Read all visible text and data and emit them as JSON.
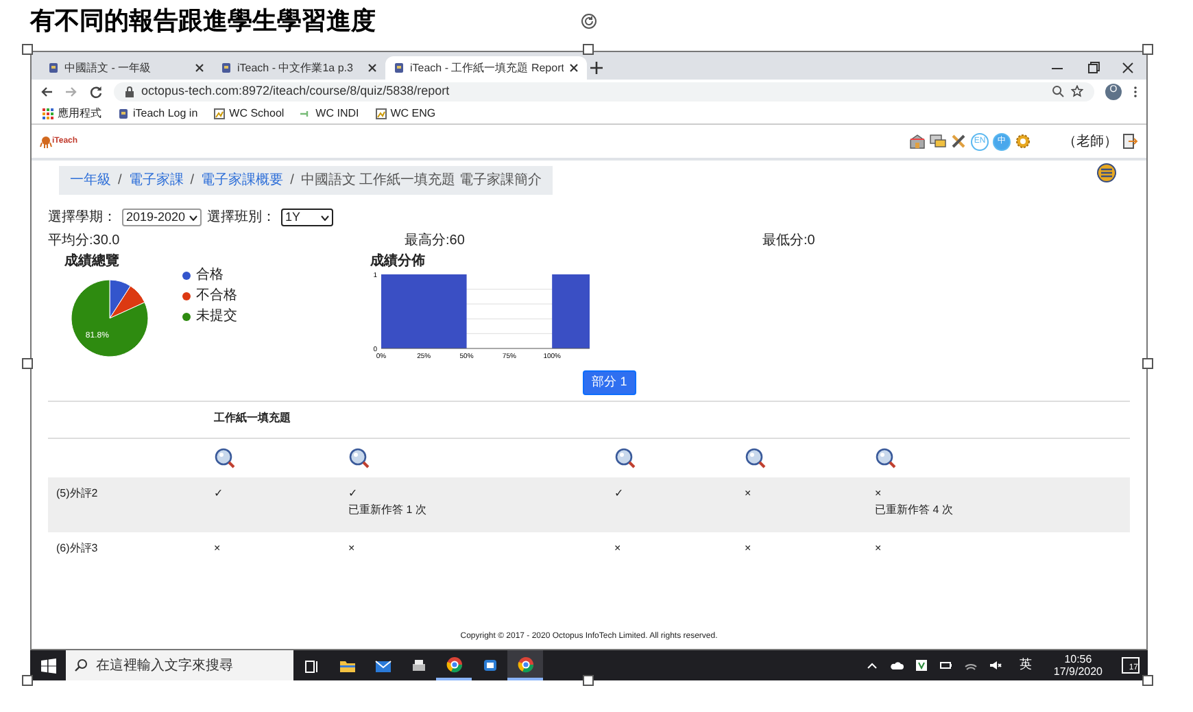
{
  "slide": {
    "title": "有不同的報告跟進學生學習進度"
  },
  "browser": {
    "tabs": [
      {
        "title": "中國語文 - 一年級",
        "selected": false
      },
      {
        "title": "iTeach - 中文作業1a p.3",
        "selected": false
      },
      {
        "title": "iTeach - 工作紙一填充題 Report",
        "selected": true
      }
    ],
    "url": "octopus-tech.com:8972/iteach/course/8/quiz/5838/report",
    "profile": "O",
    "bookmarks": [
      "應用程式",
      "iTeach Log in",
      "WC School",
      "WC INDI",
      "WC ENG"
    ]
  },
  "page": {
    "logo": "iTeach",
    "languages": [
      {
        "label": "EN",
        "selected": false
      },
      {
        "label": "中",
        "selected": true
      }
    ],
    "user": "（老師）",
    "breadcrumb_separator": "/",
    "breadcrumb": [
      {
        "label": "一年級",
        "link": true
      },
      {
        "label": "電子家課",
        "link": true
      },
      {
        "label": "電子家課概要",
        "link": true
      },
      {
        "label": "中國語文 工作紙一填充題 電子家課簡介",
        "link": false
      }
    ],
    "filters": [
      {
        "label": "選擇學期：",
        "value": "2019-2020"
      },
      {
        "label": "選擇班別：",
        "value": "1Y"
      }
    ],
    "stats": [
      "平均分:30.0",
      "最高分:60",
      "最低分:0"
    ],
    "pie": {
      "chart_data": {
        "type": "pie",
        "title": "成績總覽",
        "categories": [
          "合格",
          "不合格",
          "未提交"
        ],
        "values": [
          9.1,
          9.1,
          81.8
        ],
        "colors": [
          "#3355cc",
          "#dc3912",
          "#2e8b10"
        ],
        "value_labels": [
          null,
          null,
          "81.8%"
        ],
        "legend": "right"
      }
    },
    "histogram": {
      "chart_data": {
        "type": "bar",
        "title": "成績分佈",
        "x": [
          25,
          111
        ],
        "values": [
          1,
          1
        ],
        "xlim": [
          0,
          122
        ],
        "ylim": [
          0,
          1
        ],
        "xticks": [
          {
            "value": 0,
            "label": "0%"
          },
          {
            "value": 25,
            "label": "25%"
          },
          {
            "value": 50,
            "label": "50%"
          },
          {
            "value": 75,
            "label": "75%"
          },
          {
            "value": 100,
            "label": "100%"
          }
        ],
        "yticks": [
          0,
          1
        ]
      }
    },
    "part_button": "部分 1",
    "table": {
      "group_heading": "工作紙一填充題",
      "rows": [
        {
          "label": "(5)外評2",
          "shaded": true,
          "cells": [
            {
              "mark": "✓"
            },
            {
              "mark": "✓",
              "note": "已重新作答 1 次"
            },
            {
              "mark": "✓"
            },
            {
              "mark": "×"
            },
            {
              "mark": "×",
              "note": "已重新作答 4 次"
            }
          ]
        },
        {
          "label": "(6)外評3",
          "shaded": false,
          "cells": [
            {
              "mark": "×"
            },
            {
              "mark": "×"
            },
            {
              "mark": "×"
            },
            {
              "mark": "×"
            },
            {
              "mark": "×"
            }
          ]
        }
      ]
    },
    "footer": "Copyright © 2017 - 2020 Octopus InfoTech Limited. All rights reserved."
  },
  "taskbar": {
    "search_placeholder": "在這裡輸入文字來搜尋",
    "ime": "英",
    "time": "10:56",
    "date": "17/9/2020",
    "notifications": "17"
  }
}
